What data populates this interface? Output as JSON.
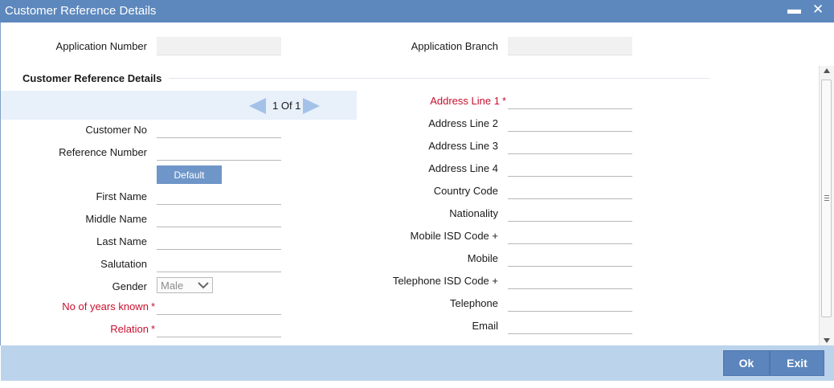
{
  "window": {
    "title": "Customer Reference Details",
    "minimize_glyph": "▬",
    "close_glyph": "✕"
  },
  "header": {
    "application_number_label": "Application Number",
    "application_number_value": "",
    "application_branch_label": "Application Branch",
    "application_branch_value": ""
  },
  "section": {
    "title": "Customer Reference Details"
  },
  "pager": {
    "text": "1 Of 1"
  },
  "left_fields": {
    "customer_no": {
      "label": "Customer No",
      "value": ""
    },
    "reference_number": {
      "label": "Reference Number",
      "value": ""
    },
    "default_button": "Default",
    "first_name": {
      "label": "First Name",
      "value": ""
    },
    "middle_name": {
      "label": "Middle Name",
      "value": ""
    },
    "last_name": {
      "label": "Last Name",
      "value": ""
    },
    "salutation": {
      "label": "Salutation",
      "value": ""
    },
    "gender": {
      "label": "Gender",
      "value": "Male"
    },
    "years_known": {
      "label": "No of years known",
      "value": "",
      "required_mark": "*"
    },
    "relation": {
      "label": "Relation",
      "value": "",
      "required_mark": "*"
    }
  },
  "right_fields": {
    "address_line_1": {
      "label": "Address Line 1",
      "value": "",
      "required_mark": "*"
    },
    "address_line_2": {
      "label": "Address Line 2",
      "value": ""
    },
    "address_line_3": {
      "label": "Address Line 3",
      "value": ""
    },
    "address_line_4": {
      "label": "Address Line 4",
      "value": ""
    },
    "country_code": {
      "label": "Country Code",
      "value": ""
    },
    "nationality": {
      "label": "Nationality",
      "value": ""
    },
    "mobile_isd": {
      "label": "Mobile ISD Code +",
      "value": ""
    },
    "mobile": {
      "label": "Mobile",
      "value": ""
    },
    "telephone_isd": {
      "label": "Telephone ISD Code +",
      "value": ""
    },
    "telephone": {
      "label": "Telephone",
      "value": ""
    },
    "email": {
      "label": "Email",
      "value": ""
    }
  },
  "footer": {
    "ok_label": "Ok",
    "exit_label": "Exit"
  },
  "colors": {
    "titlebar": "#5d88bd",
    "footer": "#bcd3ec",
    "required": "#c8102e",
    "button": "#5b85bc"
  },
  "icons": {
    "minimize": "minimize-icon",
    "close": "close-icon",
    "prev": "arrow-left-icon",
    "next": "arrow-right-icon",
    "dropdown": "chevron-down-icon"
  }
}
